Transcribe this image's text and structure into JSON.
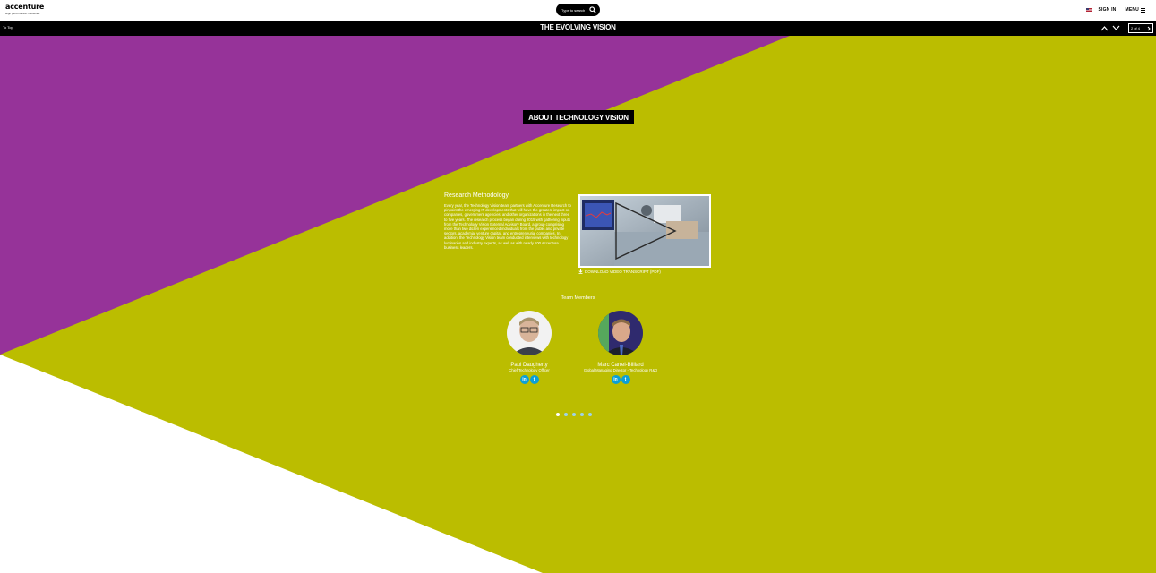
{
  "header": {
    "logo_name": "accenture",
    "logo_tagline": "High performance. Delivered.",
    "search_placeholder": "Type to search",
    "sign_in": "SIGN IN",
    "menu": "MENU"
  },
  "section_bar": {
    "to_top": "To Top",
    "title": "THE EVOLVING VISION",
    "pager_text": "2 of 4"
  },
  "content": {
    "heading": "ABOUT TECHNOLOGY VISION",
    "methodology_title": "Research Methodology",
    "methodology_body": "Every year, the Technology Vision team partners with Accenture Research to pinpoint the emerging IT developments that will have the greatest impact on companies, government agencies, and other organizations in the next three to five years. The research process began during 2015 with gathering inputs from the Technology Vision External Advisory Board, a group comprising more than two dozen experienced individuals from the public and private sectors, academia, venture capital, and entrepreneurial companies. In addition, the Technology Vision team conducted interviews with technology luminaries and industry experts, as well as with nearly 100 Accenture business leaders.",
    "download_link": "DOWNLOAD VIDEO TRANSCRIPT (PDF)",
    "team_title": "Team Members",
    "members": [
      {
        "name": "Paul Daugherty",
        "role": "Chief Technology Officer"
      },
      {
        "name": "Marc Carrel-Billiard",
        "role": "Global Managing Director - Technology R&D"
      }
    ],
    "social_labels": {
      "linkedin": "in",
      "twitter": "t"
    }
  },
  "colors": {
    "purple": "#963399",
    "olive": "#bbbd00",
    "white": "#ffffff",
    "black": "#000000",
    "social_blue": "#0a9fd8"
  },
  "pagination": {
    "count": 5,
    "active_index": 0
  }
}
